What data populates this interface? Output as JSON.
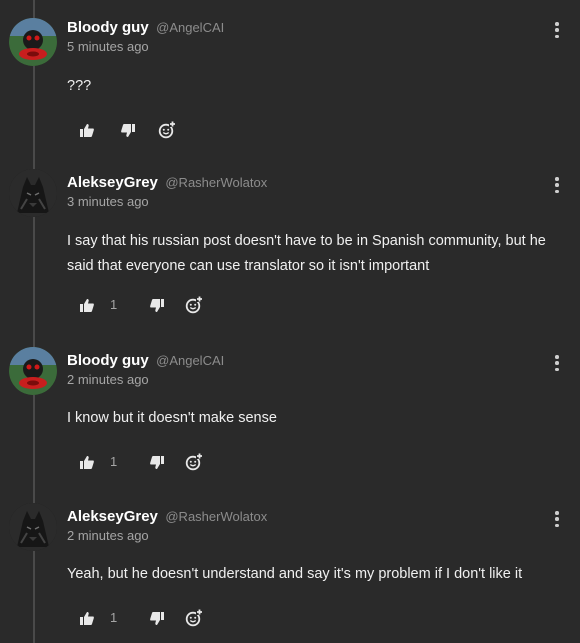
{
  "comments": [
    {
      "author": "Bloody guy",
      "handle": "@AngelCAI",
      "time": "5 minutes ago",
      "text": "???",
      "likes": "",
      "avatar": "red-flower-avatar"
    },
    {
      "author": "AlekseyGrey",
      "handle": "@RasherWolatox",
      "time": "3 minutes ago",
      "text": "I say that his russian post doesn't have to be in Spanish community, but he said that everyone can use translator so it isn't important",
      "likes": "1",
      "avatar": "dark-wolf-avatar"
    },
    {
      "author": "Bloody guy",
      "handle": "@AngelCAI",
      "time": "2 minutes ago",
      "text": "I know but it doesn't make sense",
      "likes": "1",
      "avatar": "red-flower-avatar"
    },
    {
      "author": "AlekseyGrey",
      "handle": "@RasherWolatox",
      "time": "2 minutes ago",
      "text": "Yeah, but he doesn't understand and say it's my problem if I don't like it",
      "likes": "1",
      "avatar": "dark-wolf-avatar"
    }
  ],
  "colors": {
    "background": "#2a2a2a",
    "text": "#f0f0f0",
    "muted": "#a5a5a5",
    "thread_line": "#4a4a4a"
  },
  "icons": [
    "thumbs-up-icon",
    "thumbs-down-icon",
    "reply-emoji-icon",
    "more-options-icon"
  ]
}
